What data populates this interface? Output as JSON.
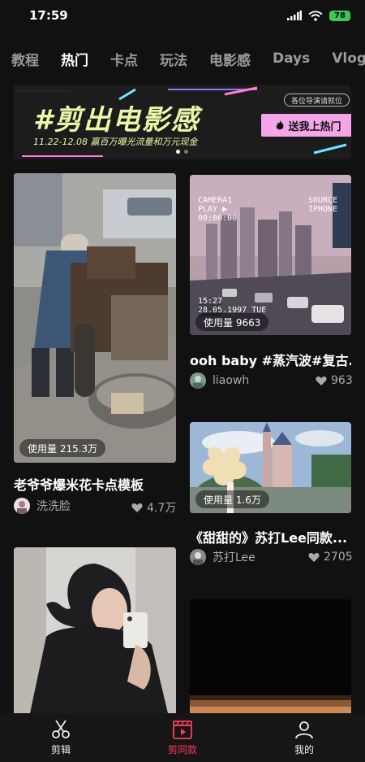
{
  "status_bar": {
    "time": "17:59",
    "battery": "78"
  },
  "tabs": [
    {
      "label": "教程",
      "active": false
    },
    {
      "label": "热门",
      "active": true
    },
    {
      "label": "卡点",
      "active": false
    },
    {
      "label": "玩法",
      "active": false
    },
    {
      "label": "电影感",
      "active": false
    },
    {
      "label": "Days",
      "active": false
    },
    {
      "label": "Vlog",
      "active": false
    }
  ],
  "banner": {
    "title": "#剪出电影感",
    "subtitle": "11.22-12.08  赢百万曝光流量和万元现金",
    "badge": "各位导演请就位",
    "cta": "送我上热门",
    "page_indicator": {
      "count": 2,
      "active": 0
    }
  },
  "cards": [
    {
      "usage": "使用量 215.3万",
      "title": "老爷爷爆米花卡点模板",
      "author": "洗洗脸",
      "likes": "4.7万"
    },
    {
      "usage": "使用量 9663",
      "title": "ooh baby #蒸汽波#复古...",
      "author": "liaowh",
      "likes": "963"
    },
    {
      "usage": "使用量 1.6万",
      "title": "《甜甜的》苏打Lee同款...",
      "author": "苏打Lee",
      "likes": "2705"
    }
  ],
  "vhs_overlay": {
    "camera": "CAMERA1",
    "play": "PLAY ▶",
    "counter": "00:00:00",
    "source": "SOURCE",
    "device": "IPHONE",
    "clock": "15:27",
    "date": "28.05.1997 TUE"
  },
  "bottom_nav": [
    {
      "label": "剪辑",
      "icon": "scissors-icon",
      "active": false
    },
    {
      "label": "剪同款",
      "icon": "clapperboard-icon",
      "active": true
    },
    {
      "label": "我的",
      "icon": "person-icon",
      "active": false
    }
  ],
  "colors": {
    "accent": "#ff3d5e",
    "background": "#111111",
    "banner_text": "#e8f8a8",
    "cta": "#f4a6e8"
  }
}
